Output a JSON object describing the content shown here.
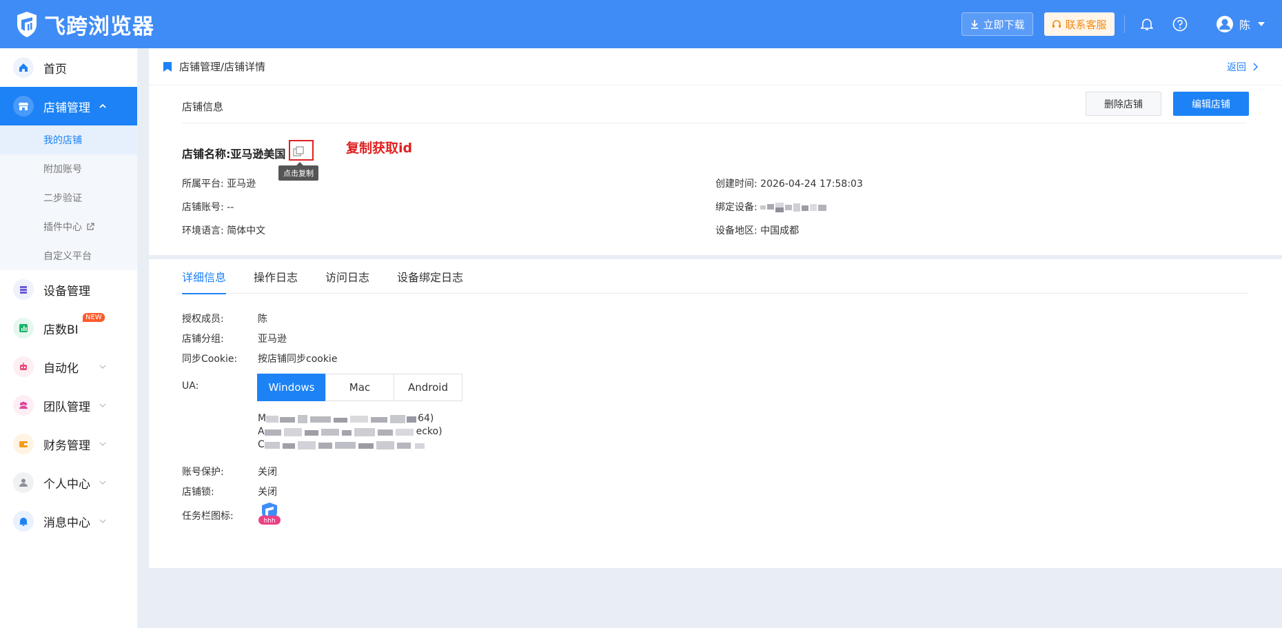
{
  "app": {
    "title": "飞跨浏览器"
  },
  "topbar": {
    "download_label": "立即下载",
    "support_label": "联系客服",
    "user_name": "陈"
  },
  "sidebar": {
    "items": [
      {
        "label": "首页",
        "icon": "home-icon"
      },
      {
        "label": "店铺管理",
        "icon": "store-icon",
        "active": true
      },
      {
        "label": "设备管理",
        "icon": "device-icon"
      },
      {
        "label": "店数BI",
        "icon": "chart-icon",
        "badge": "NEW"
      },
      {
        "label": "自动化",
        "icon": "robot-icon"
      },
      {
        "label": "团队管理",
        "icon": "team-icon"
      },
      {
        "label": "财务管理",
        "icon": "wallet-icon"
      },
      {
        "label": "个人中心",
        "icon": "person-icon"
      },
      {
        "label": "消息中心",
        "icon": "bell-icon"
      }
    ],
    "sub_items": [
      "我的店铺",
      "附加账号",
      "二步验证",
      "插件中心",
      "自定义平台"
    ]
  },
  "breadcrumb": {
    "text": "店铺管理/店铺详情",
    "back": "返回"
  },
  "info": {
    "section_title": "店铺信息",
    "delete_label": "删除店铺",
    "edit_label": "编辑店铺",
    "shop_name_label": "店铺名称:",
    "shop_name": "亚马逊美国",
    "tooltip": "点击复制",
    "annotation": "复制获取id",
    "platform_label": "所属平台:",
    "platform": "亚马逊",
    "account_label": "店铺账号:",
    "account": "--",
    "lang_label": "环境语言:",
    "lang": "简体中文",
    "created_label": "创建时间:",
    "created": "2026-04-24 17:58:03",
    "device_label": "绑定设备:",
    "region_label": "设备地区:",
    "region": "中国成都"
  },
  "tabs": [
    "详细信息",
    "操作日志",
    "访问日志",
    "设备绑定日志"
  ],
  "detail": {
    "members_label": "授权成员:",
    "members": "陈",
    "group_label": "店铺分组:",
    "group": "亚马逊",
    "cookie_label": "同步Cookie:",
    "cookie": "按店铺同步cookie",
    "ua_label": "UA:",
    "ua_options": [
      "Windows",
      "Mac",
      "Android"
    ],
    "ua_lines": [
      {
        "start": "M",
        "end": "64)"
      },
      {
        "start": "A",
        "end": "ecko)"
      },
      {
        "start": "C",
        "end": ""
      }
    ],
    "protect_label": "账号保护:",
    "protect": "关闭",
    "lock_label": "店铺锁:",
    "lock": "关闭",
    "taskbar_label": "任务栏图标:",
    "taskbar_badge": "hhh"
  },
  "colors": {
    "primary": "#1d82f5",
    "topbar": "#3f8cf6",
    "annotation": "#e02020"
  }
}
